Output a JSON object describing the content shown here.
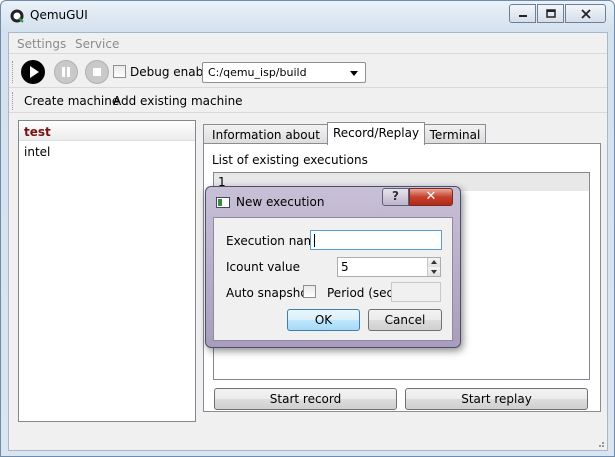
{
  "window": {
    "title": "QemuGUI",
    "app_icon": "qemu-logo-icon"
  },
  "menubar": {
    "items": [
      "Settings",
      "Service"
    ]
  },
  "toolbar": {
    "debug_label": "Debug enable",
    "debug_checked": false,
    "build_path": "C:/qemu_isp/build",
    "icons": [
      "play-icon",
      "pause-icon",
      "stop-icon"
    ]
  },
  "actions": {
    "create_machine": "Create machine",
    "add_existing": "Add existing machine"
  },
  "machines": [
    {
      "name": "test",
      "selected": true
    },
    {
      "name": "intel",
      "selected": false
    }
  ],
  "tabs": [
    {
      "label": "Information about VM",
      "active": false
    },
    {
      "label": "Record/Replay",
      "active": true
    },
    {
      "label": "Terminal",
      "active": false
    }
  ],
  "record_replay": {
    "list_label": "List of existing executions",
    "executions": [
      "1"
    ],
    "start_record": "Start record",
    "start_replay": "Start replay"
  },
  "dialog": {
    "title": "New execution",
    "help_glyph": "?",
    "close_glyph": "✕",
    "execution_name_label": "Execution name",
    "execution_name_value": "",
    "icount_label": "Icount value",
    "icount_value": "5",
    "auto_snapshot_label": "Auto snapshot",
    "auto_snapshot_checked": false,
    "period_label": "Period (sec)",
    "period_value": "",
    "ok": "OK",
    "cancel": "Cancel"
  }
}
